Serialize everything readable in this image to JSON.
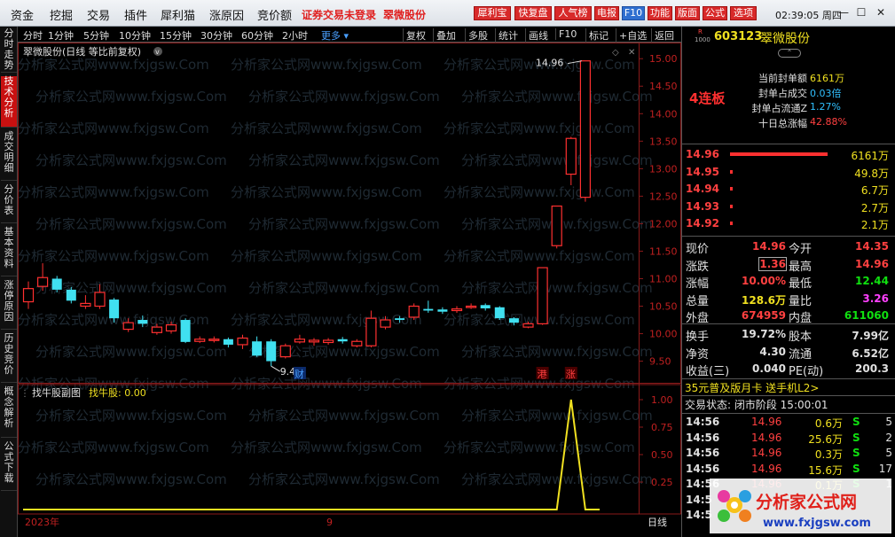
{
  "menu": {
    "items": [
      "资金",
      "挖掘",
      "交易",
      "插件",
      "犀利猫",
      "涨原因",
      "竞价额"
    ],
    "warn_login": "证券交易未登录",
    "stock_name": "翠微股份",
    "tool_buttons": [
      "犀利宝",
      "快复盘",
      "人气榜",
      "电报",
      "F10",
      "功能",
      "版面",
      "公式",
      "选项"
    ],
    "clock": "02:39:05 周四",
    "win_buttons": [
      "—",
      "☐",
      "✕"
    ]
  },
  "left_tabs": [
    "分时走势",
    "技术分析",
    "成交明细",
    "分价表",
    "基本资料",
    "涨停原因",
    "历史竞价",
    "概念解析",
    "公式下载"
  ],
  "period_bar": {
    "items": [
      "分时",
      "1分钟",
      "5分钟",
      "10分钟",
      "15分钟",
      "30分钟",
      "60分钟",
      "2小时"
    ],
    "more": "更多",
    "tools": [
      "复权",
      "叠加",
      "多股",
      "统计",
      "画线",
      "F10",
      "标记",
      "+自选",
      "返回"
    ]
  },
  "main_chart": {
    "title": "翠微股份(日线 等比前复权)",
    "high_label": "14.96",
    "low_label": "9.41",
    "price_ticks": [
      "15.00",
      "14.50",
      "14.00",
      "13.50",
      "13.00",
      "12.50",
      "12.00",
      "11.50",
      "11.00",
      "10.50",
      "10.00",
      "9.50"
    ],
    "markers": {
      "cai": "财",
      "gang": "港",
      "zhang": "涨"
    },
    "watermark": "分析家公式网www.fxjgsw.Com"
  },
  "chart_data": {
    "type": "candlestick",
    "ylim": [
      9.3,
      15.1
    ],
    "up_color": "#ff3030",
    "down_color": "#40e0f0",
    "candles": [
      {
        "o": 10.58,
        "c": 10.82,
        "h": 10.95,
        "l": 10.45
      },
      {
        "o": 10.86,
        "c": 11.02,
        "h": 11.28,
        "l": 10.78
      },
      {
        "o": 11.0,
        "c": 10.8,
        "h": 11.05,
        "l": 10.75
      },
      {
        "o": 10.8,
        "c": 10.6,
        "h": 10.85,
        "l": 10.55
      },
      {
        "o": 10.5,
        "c": 10.55,
        "h": 10.7,
        "l": 10.45
      },
      {
        "o": 10.5,
        "c": 10.75,
        "h": 10.9,
        "l": 10.45
      },
      {
        "o": 10.62,
        "c": 10.28,
        "h": 10.65,
        "l": 10.2
      },
      {
        "o": 10.08,
        "c": 10.2,
        "h": 10.28,
        "l": 10.03
      },
      {
        "o": 10.25,
        "c": 10.18,
        "h": 10.33,
        "l": 10.12
      },
      {
        "o": 10.02,
        "c": 10.12,
        "h": 10.18,
        "l": 9.98
      },
      {
        "o": 10.05,
        "c": 10.16,
        "h": 10.22,
        "l": 10.0
      },
      {
        "o": 10.25,
        "c": 9.85,
        "h": 10.28,
        "l": 9.83
      },
      {
        "o": 9.86,
        "c": 9.9,
        "h": 9.95,
        "l": 9.83
      },
      {
        "o": 9.88,
        "c": 9.9,
        "h": 9.95,
        "l": 9.84
      },
      {
        "o": 9.9,
        "c": 9.8,
        "h": 9.93,
        "l": 9.75
      },
      {
        "o": 9.8,
        "c": 9.92,
        "h": 9.98,
        "l": 9.72
      },
      {
        "o": 9.86,
        "c": 9.6,
        "h": 9.95,
        "l": 9.58
      },
      {
        "o": 9.86,
        "c": 9.5,
        "h": 9.9,
        "l": 9.41
      },
      {
        "o": 9.58,
        "c": 9.78,
        "h": 9.82,
        "l": 9.55
      },
      {
        "o": 9.85,
        "c": 9.9,
        "h": 9.98,
        "l": 9.82
      },
      {
        "o": 9.85,
        "c": 9.88,
        "h": 9.92,
        "l": 9.78
      },
      {
        "o": 9.84,
        "c": 9.88,
        "h": 9.92,
        "l": 9.8
      },
      {
        "o": 9.9,
        "c": 9.86,
        "h": 9.94,
        "l": 9.82
      },
      {
        "o": 9.78,
        "c": 9.86,
        "h": 9.9,
        "l": 9.75
      },
      {
        "o": 9.78,
        "c": 10.28,
        "h": 10.42,
        "l": 9.75
      },
      {
        "o": 10.12,
        "c": 10.25,
        "h": 10.32,
        "l": 10.08
      },
      {
        "o": 10.28,
        "c": 10.25,
        "h": 10.32,
        "l": 10.2
      },
      {
        "o": 10.3,
        "c": 10.5,
        "h": 10.55,
        "l": 10.25
      },
      {
        "o": 10.45,
        "c": 10.42,
        "h": 10.6,
        "l": 10.38
      },
      {
        "o": 10.44,
        "c": 10.4,
        "h": 10.48,
        "l": 10.36
      },
      {
        "o": 10.42,
        "c": 10.45,
        "h": 10.5,
        "l": 10.38
      },
      {
        "o": 10.48,
        "c": 10.5,
        "h": 10.55,
        "l": 10.45
      },
      {
        "o": 10.52,
        "c": 10.46,
        "h": 10.55,
        "l": 10.42
      },
      {
        "o": 10.48,
        "c": 10.28,
        "h": 10.5,
        "l": 10.25
      },
      {
        "o": 10.28,
        "c": 10.2,
        "h": 10.3,
        "l": 10.15
      },
      {
        "o": 10.12,
        "c": 10.18,
        "h": 10.22,
        "l": 10.1
      },
      {
        "o": 10.18,
        "c": 11.2,
        "h": 11.2,
        "l": 10.16
      },
      {
        "o": 11.6,
        "c": 12.32,
        "h": 12.32,
        "l": 11.55
      },
      {
        "o": 12.9,
        "c": 13.55,
        "h": 13.58,
        "l": 12.7
      },
      {
        "o": 12.48,
        "c": 14.96,
        "h": 14.96,
        "l": 12.4
      }
    ]
  },
  "sub_chart": {
    "title": "找牛股副图",
    "value_label": "找牛股: 0.00",
    "ticks": [
      "1.00",
      "0.75",
      "0.50",
      "0.25"
    ],
    "values": [
      0,
      0,
      0,
      0,
      0,
      0,
      0,
      0,
      0,
      0,
      0,
      0,
      0,
      0,
      0,
      0,
      0,
      0,
      0,
      0,
      0,
      0,
      0,
      0,
      0,
      0,
      0,
      0,
      0,
      0,
      0,
      0,
      0,
      0,
      0,
      0,
      0,
      0,
      1,
      0,
      0
    ],
    "year_label": "2023年",
    "month_label": "9",
    "period_label": "日线"
  },
  "quote": {
    "code": "603123",
    "name": "翠微股份",
    "tag": "R",
    "tag2": "1000",
    "board": "4连板",
    "seal_rows": [
      {
        "k": "当前封单额",
        "v": "6161万"
      },
      {
        "k": "封单占成交",
        "v": "0.03倍"
      },
      {
        "k": "封单占流通Z",
        "v": "1.27%"
      },
      {
        "k": "十日总涨幅",
        "v": "42.88%"
      }
    ],
    "bids": [
      {
        "p": "14.96",
        "v": "6161万"
      },
      {
        "p": "14.95",
        "v": "49.8万"
      },
      {
        "p": "14.94",
        "v": "6.7万"
      },
      {
        "p": "14.93",
        "v": "2.7万"
      },
      {
        "p": "14.92",
        "v": "2.1万"
      }
    ],
    "bid_fill": [
      1,
      0.02,
      0.01,
      0.01,
      0.01
    ],
    "stats": [
      {
        "k1": "现价",
        "v1": "14.96",
        "k2": "今开",
        "v2": "14.35"
      },
      {
        "k1": "涨跌",
        "v1": "1.36",
        "k2": "最高",
        "v2": "14.96"
      },
      {
        "k1": "涨幅",
        "v1": "10.00%",
        "k2": "最低",
        "v2": "12.44"
      },
      {
        "k1": "总量",
        "v1": "128.6万",
        "k2": "量比",
        "v2": "3.26"
      },
      {
        "k1": "外盘",
        "v1": "674959",
        "k2": "内盘",
        "v2": "611060"
      }
    ],
    "stats2": [
      {
        "k1": "换手",
        "v1": "19.72%",
        "k2": "股本",
        "v2": "7.99亿"
      },
      {
        "k1": "净资",
        "v1": "4.30",
        "k2": "流通",
        "v2": "6.52亿"
      },
      {
        "k1": "收益(三)",
        "v1": "0.040",
        "k2": "PE(动)",
        "v2": "200.3"
      }
    ],
    "promo": "35元普及版月卡 送手机L2>",
    "trade_status": "交易状态: 闭市阶段 15:00:01",
    "ticks": [
      {
        "t": "14:56",
        "p": "14.96",
        "v": "0.6万",
        "s": "S",
        "n": "5"
      },
      {
        "t": "14:56",
        "p": "14.96",
        "v": "25.6万",
        "s": "S",
        "n": "2"
      },
      {
        "t": "14:56",
        "p": "14.96",
        "v": "0.3万",
        "s": "S",
        "n": "5"
      },
      {
        "t": "14:56",
        "p": "14.96",
        "v": "15.6万",
        "s": "S",
        "n": "17"
      },
      {
        "t": "14:56",
        "p": "14.96",
        "v": "0.1万",
        "s": "S",
        "n": "1"
      },
      {
        "t": "14:5",
        "p": "",
        "v": "",
        "s": "",
        "n": ""
      },
      {
        "t": "14:5",
        "p": "",
        "v": "",
        "s": "",
        "n": ""
      }
    ]
  },
  "logo": {
    "main": "分析家公式网",
    "url": "www.fxjgsw.com"
  }
}
